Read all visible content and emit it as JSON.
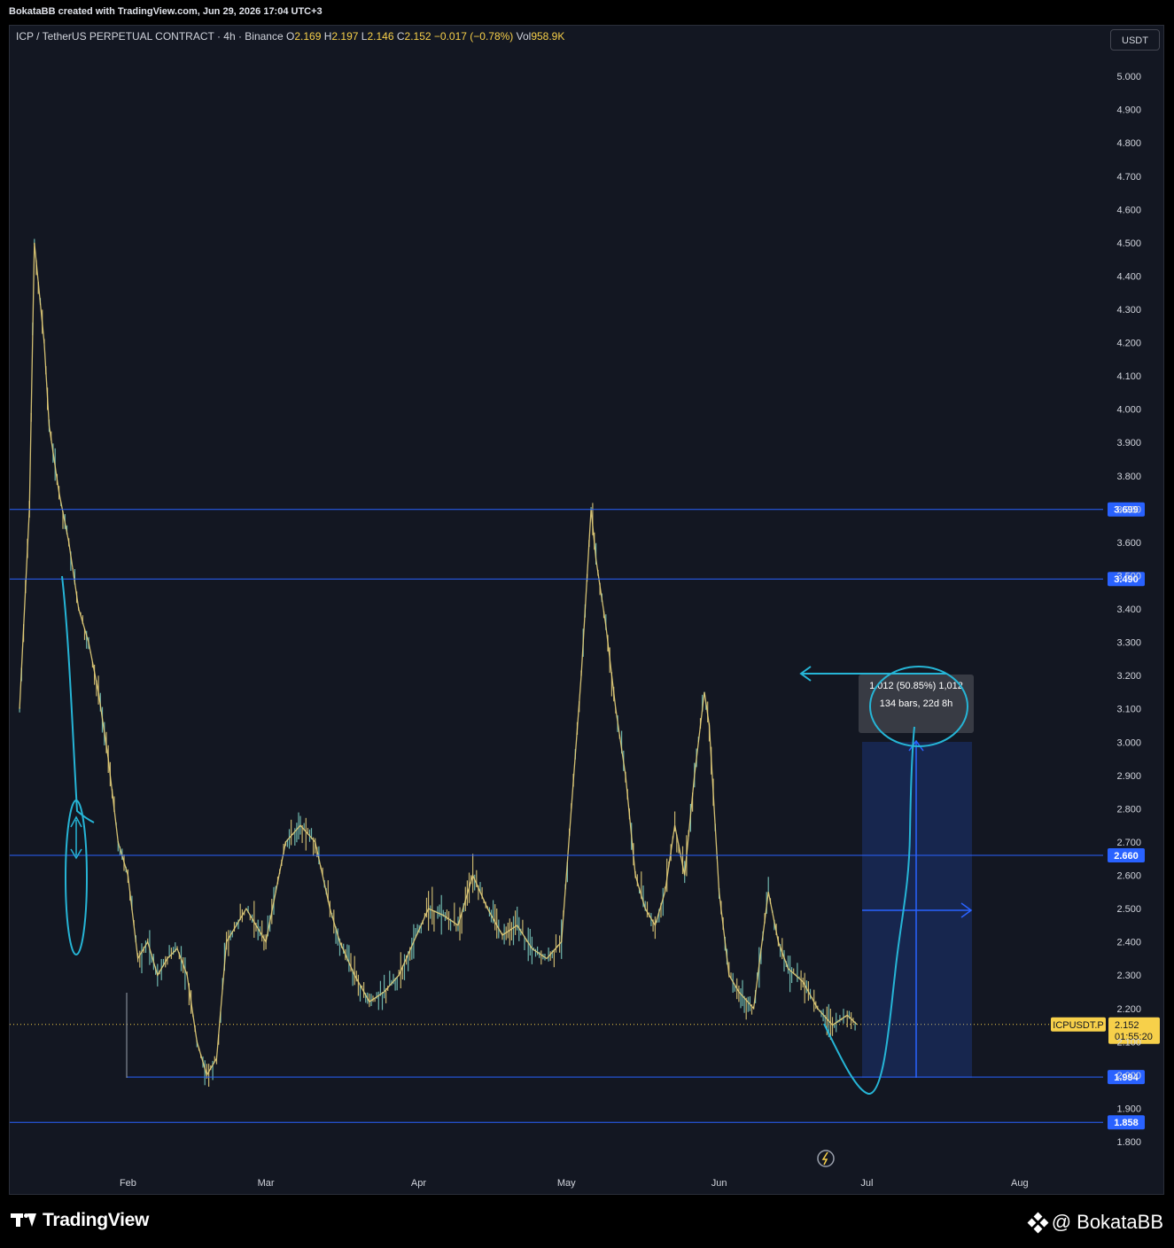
{
  "header": {
    "created_by": "BokataBB created with TradingView.com, Jun 29, 2026 17:04 UTC+3"
  },
  "legend": {
    "symbol": "ICP / TetherUS PERPETUAL CONTRACT · 4h · Binance",
    "o_label": "O",
    "o_value": "2.169",
    "h_label": "H",
    "h_value": "2.197",
    "l_label": "L",
    "l_value": "2.146",
    "c_label": "C",
    "c_value": "2.152",
    "change": "−0.017 (−0.78%)",
    "vol_label": "Vol",
    "vol_value": "958.9K"
  },
  "toolbar": {
    "currency": "USDT"
  },
  "price_tag": {
    "symbol": "ICPUSDT.P",
    "price": "2.152",
    "countdown": "01:55:20"
  },
  "measure": {
    "line1": "1.012 (50.85%) 1,012",
    "line2": "134 bars, 22d 8h"
  },
  "footer": {
    "brand": "TradingView",
    "author": "@ BokataBB"
  },
  "colors": {
    "background": "#131722",
    "level_line": "#2962ff",
    "drawing": "#26b5d6",
    "price_yellow": "#f7d04a",
    "candle_up": "#7fd1c4",
    "candle_down": "#e7d07a"
  },
  "chart_data": {
    "type": "line",
    "title": "ICP / TetherUS PERPETUAL CONTRACT · 4h · Binance",
    "x_ticks": [
      "Feb",
      "Mar",
      "Apr",
      "May",
      "Jun",
      "Jul",
      "Aug"
    ],
    "y_ticks": [
      "1.800",
      "1.900",
      "2.000",
      "2.100",
      "2.200",
      "2.300",
      "2.400",
      "2.500",
      "2.600",
      "2.700",
      "2.800",
      "2.900",
      "3.000",
      "3.100",
      "3.200",
      "3.300",
      "3.400",
      "3.500",
      "3.600",
      "3.700",
      "3.800",
      "3.900",
      "4.000",
      "4.100",
      "4.200",
      "4.300",
      "4.400",
      "4.500",
      "4.600",
      "4.700",
      "4.800",
      "4.900",
      "5.000"
    ],
    "ylim": [
      1.8,
      5.0
    ],
    "current_price": 2.152,
    "horizontal_levels": [
      {
        "label": "3.699",
        "value": 3.699
      },
      {
        "label": "3.490",
        "value": 3.49
      },
      {
        "label": "2.660",
        "value": 2.66
      },
      {
        "label": "1.994",
        "value": 1.994
      },
      {
        "label": "1.858",
        "value": 1.858
      }
    ],
    "series": [
      {
        "x": [
          "2026-01-10",
          "2026-01-12",
          "2026-01-13",
          "2026-01-15",
          "2026-01-16",
          "2026-01-18",
          "2026-01-20",
          "2026-01-22",
          "2026-01-24",
          "2026-01-26",
          "2026-01-28",
          "2026-01-30",
          "2026-02-01",
          "2026-02-03",
          "2026-02-05",
          "2026-02-07",
          "2026-02-09",
          "2026-02-11",
          "2026-02-13",
          "2026-02-15",
          "2026-02-17",
          "2026-02-19",
          "2026-02-21",
          "2026-02-23",
          "2026-02-25",
          "2026-02-27",
          "2026-03-01",
          "2026-03-03",
          "2026-03-05",
          "2026-03-08",
          "2026-03-11",
          "2026-03-14",
          "2026-03-16",
          "2026-03-19",
          "2026-03-22",
          "2026-03-25",
          "2026-03-28",
          "2026-03-31",
          "2026-04-03",
          "2026-04-06",
          "2026-04-09",
          "2026-04-12",
          "2026-04-15",
          "2026-04-18",
          "2026-04-21",
          "2026-04-24",
          "2026-04-27",
          "2026-04-30",
          "2026-05-02",
          "2026-05-04",
          "2026-05-06",
          "2026-05-07",
          "2026-05-09",
          "2026-05-11",
          "2026-05-13",
          "2026-05-15",
          "2026-05-17",
          "2026-05-19",
          "2026-05-21",
          "2026-05-23",
          "2026-05-25",
          "2026-05-27",
          "2026-05-29",
          "2026-05-30",
          "2026-06-01",
          "2026-06-03",
          "2026-06-05",
          "2026-06-08",
          "2026-06-11",
          "2026-06-13",
          "2026-06-15",
          "2026-06-18",
          "2026-06-21",
          "2026-06-24",
          "2026-06-27",
          "2026-06-29"
        ],
        "y": [
          3.1,
          3.7,
          4.5,
          4.2,
          3.95,
          3.75,
          3.6,
          3.4,
          3.3,
          3.15,
          2.95,
          2.7,
          2.6,
          2.35,
          2.4,
          2.3,
          2.35,
          2.38,
          2.3,
          2.1,
          2.0,
          2.05,
          2.4,
          2.45,
          2.5,
          2.45,
          2.4,
          2.55,
          2.7,
          2.75,
          2.7,
          2.5,
          2.4,
          2.3,
          2.22,
          2.25,
          2.3,
          2.4,
          2.5,
          2.48,
          2.45,
          2.6,
          2.5,
          2.42,
          2.45,
          2.38,
          2.35,
          2.4,
          2.8,
          3.2,
          3.7,
          3.55,
          3.35,
          3.1,
          2.9,
          2.6,
          2.5,
          2.45,
          2.55,
          2.75,
          2.6,
          2.9,
          3.15,
          3.05,
          2.55,
          2.3,
          2.25,
          2.2,
          2.55,
          2.4,
          2.32,
          2.28,
          2.2,
          2.15,
          2.18,
          2.152
        ]
      }
    ]
  }
}
